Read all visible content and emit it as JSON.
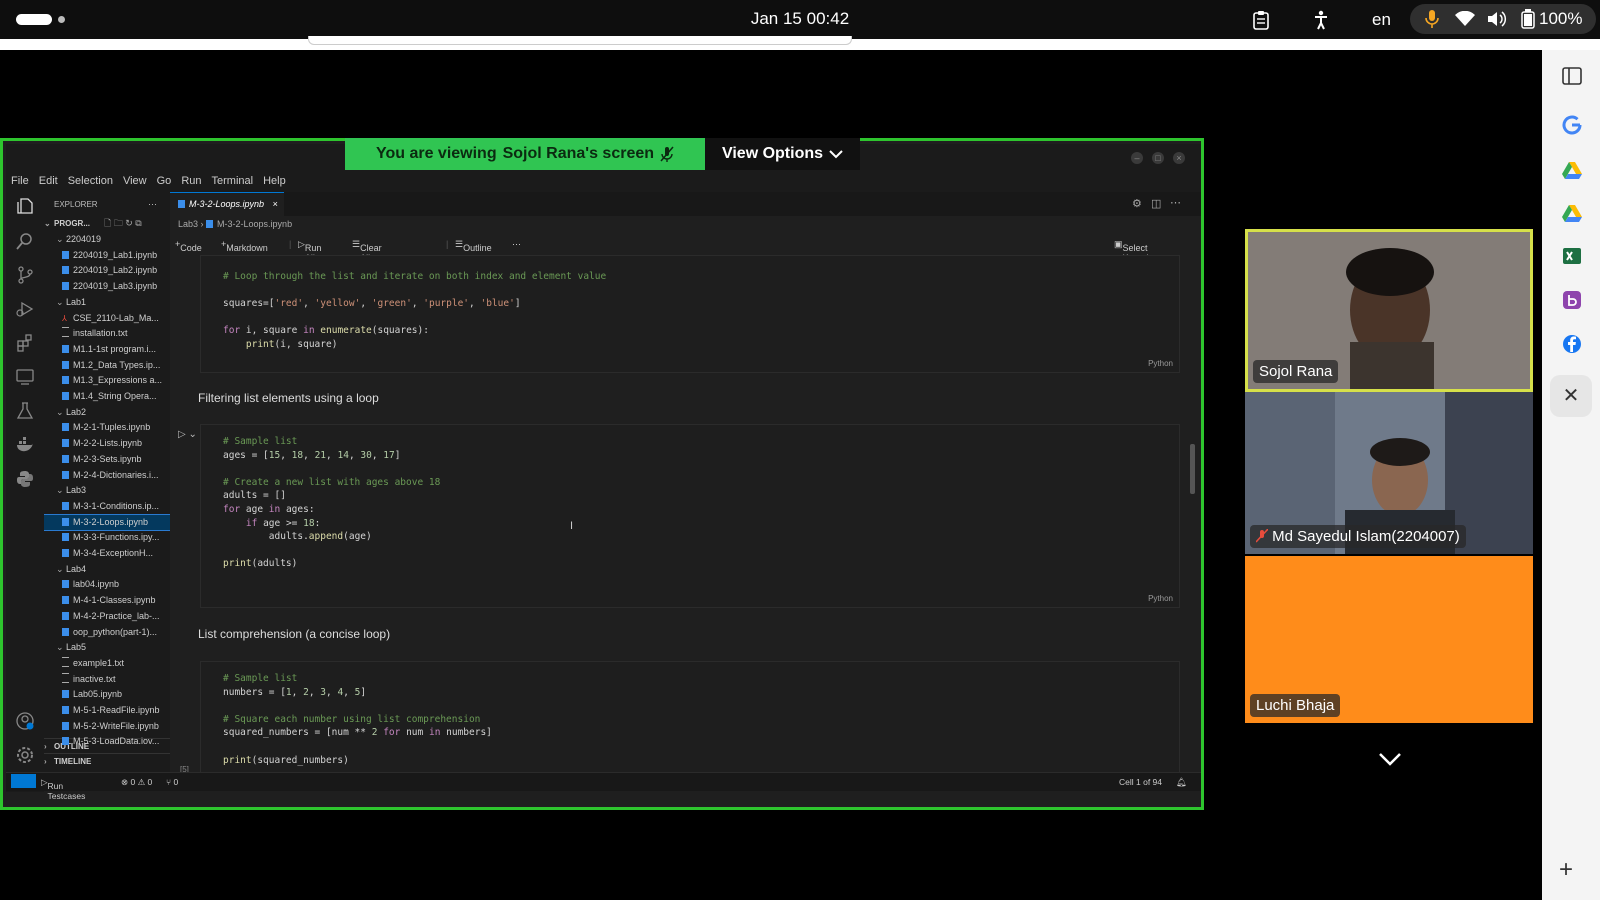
{
  "system_bar": {
    "clock": "Jan 15  00:42",
    "language": "en",
    "battery": "100%"
  },
  "meet": {
    "banner_prefix": "You are viewing",
    "banner_name": "Sojol Rana's screen",
    "view_options": "View Options",
    "participants": [
      {
        "name": "Sojol Rana"
      },
      {
        "name": "Md Sayedul Islam(2204007)"
      },
      {
        "name": "Luchi Bhaja"
      }
    ],
    "accent": "#2ec52e",
    "tile3_color": "#ff8c1a"
  },
  "vscode": {
    "menu": [
      "File",
      "Edit",
      "Selection",
      "View",
      "Go",
      "Run",
      "Terminal",
      "Help"
    ],
    "explorer_title": "EXPLORER",
    "folder_label": "PROGR...",
    "tree": [
      {
        "label": "2204019",
        "type": "folder"
      },
      {
        "label": "2204019_Lab1.ipynb",
        "type": "nb"
      },
      {
        "label": "2204019_Lab2.ipynb",
        "type": "nb"
      },
      {
        "label": "2204019_Lab3.ipynb",
        "type": "nb"
      },
      {
        "label": "Lab1",
        "type": "folder"
      },
      {
        "label": "CSE_2110-Lab_Ma...",
        "type": "pdf"
      },
      {
        "label": "installation.txt",
        "type": "txt"
      },
      {
        "label": "M1.1-1st program.i...",
        "type": "nb"
      },
      {
        "label": "M1.2_Data Types.ip...",
        "type": "nb"
      },
      {
        "label": "M1.3_Expressions a...",
        "type": "nb"
      },
      {
        "label": "M1.4_String Opera...",
        "type": "nb"
      },
      {
        "label": "Lab2",
        "type": "folder"
      },
      {
        "label": "M-2-1-Tuples.ipynb",
        "type": "nb"
      },
      {
        "label": "M-2-2-Lists.ipynb",
        "type": "nb"
      },
      {
        "label": "M-2-3-Sets.ipynb",
        "type": "nb"
      },
      {
        "label": "M-2-4-Dictionaries.i...",
        "type": "nb"
      },
      {
        "label": "Lab3",
        "type": "folder"
      },
      {
        "label": "M-3-1-Conditions.ip...",
        "type": "nb"
      },
      {
        "label": "M-3-2-Loops.ipynb",
        "type": "nb",
        "selected": true
      },
      {
        "label": "M-3-3-Functions.ipy...",
        "type": "nb"
      },
      {
        "label": "M-3-4-ExceptionH...",
        "type": "nb"
      },
      {
        "label": "Lab4",
        "type": "folder"
      },
      {
        "label": "lab04.ipynb",
        "type": "nb"
      },
      {
        "label": "M-4-1-Classes.ipynb",
        "type": "nb"
      },
      {
        "label": "M-4-2-Practice_lab-...",
        "type": "nb"
      },
      {
        "label": "oop_python(part-1)...",
        "type": "nb"
      },
      {
        "label": "Lab5",
        "type": "folder"
      },
      {
        "label": "example1.txt",
        "type": "txt"
      },
      {
        "label": "inactive.txt",
        "type": "txt"
      },
      {
        "label": "Lab05.ipynb",
        "type": "nb"
      },
      {
        "label": "M-5-1-ReadFile.ipynb",
        "type": "nb"
      },
      {
        "label": "M-5-2-WriteFile.ipynb",
        "type": "nb"
      },
      {
        "label": "M-5-3-LoadData.iov...",
        "type": "nb"
      }
    ],
    "outline": "OUTLINE",
    "timeline": "TIMELINE",
    "tab": "M-3-2-Loops.ipynb",
    "breadcrumb": {
      "folder": "Lab3",
      "file": "M-3-2-Loops.ipynb"
    },
    "toolbar": {
      "code": "Code",
      "markdown": "Markdown",
      "run_all": "Run All",
      "clear": "Clear All Outputs",
      "outline": "Outline",
      "kernel": "Select Kernel"
    },
    "cell1_lines": [
      "# Loop through the list and iterate on both index and element value",
      "",
      "squares=['red', 'yellow', 'green', 'purple', 'blue']",
      "",
      "for i, square in enumerate(squares):",
      "    print(i, square)"
    ],
    "md1": "Filtering list elements using a loop",
    "cell2_lines": [
      "# Sample list",
      "ages = [15, 18, 21, 14, 30, 17]",
      "",
      "# Create a new list with ages above 18",
      "adults = []",
      "for age in ages:",
      "    if age >= 18:",
      "        adults.append(age)",
      "",
      "print(adults)"
    ],
    "md2": "List comprehension (a concise loop)",
    "cell3_lines": [
      "# Sample list",
      "numbers = [1, 2, 3, 4, 5]",
      "",
      "# Square each number using list comprehension",
      "squared_numbers = [num ** 2 for num in numbers]",
      "",
      "print(squared_numbers)"
    ],
    "cell_lang": "Python",
    "exec_count": "[5]",
    "status": {
      "run_testcases": "Run Testcases",
      "problems": "⊗ 0 ⚠ 0",
      "ports": "⑂ 0",
      "cell_pos": "Cell 1 of 94"
    }
  }
}
